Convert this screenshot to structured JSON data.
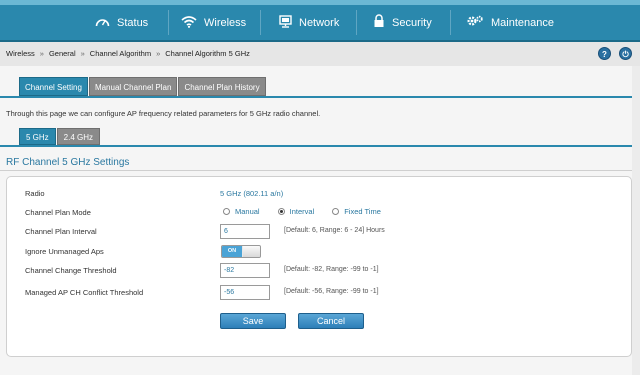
{
  "nav": {
    "items": [
      {
        "label": "Status",
        "icon": "gauge-icon"
      },
      {
        "label": "Wireless",
        "icon": "wifi-icon"
      },
      {
        "label": "Network",
        "icon": "network-icon"
      },
      {
        "label": "Security",
        "icon": "lock-icon"
      },
      {
        "label": "Maintenance",
        "icon": "gear-icon"
      }
    ],
    "active": "Wireless"
  },
  "breadcrumb": [
    "Wireless",
    "General",
    "Channel Algorithm",
    "Channel Algorithm 5 GHz"
  ],
  "breadcrumb_sep": "»",
  "help": {
    "help_label": "?",
    "logout_label": "⏻"
  },
  "tabs": [
    "Channel Setting",
    "Manual Channel Plan",
    "Channel Plan History"
  ],
  "intro": "Through this page we can configure AP frequency related parameters for 5 GHz radio channel.",
  "subtabs": [
    "5 GHz",
    "2.4 GHz"
  ],
  "section_title": "RF Channel 5 GHz Settings",
  "form": {
    "radio": {
      "label": "Radio",
      "value": "5 GHz (802.11 a/n)"
    },
    "plan_mode": {
      "label": "Channel Plan Mode",
      "options": [
        "Manual",
        "Interval",
        "Fixed Time"
      ],
      "selected": "Interval"
    },
    "plan_interval": {
      "label": "Channel Plan Interval",
      "value": "6",
      "hint": "[Default: 6, Range: 6 - 24] Hours"
    },
    "ignore_unmanaged": {
      "label": "Ignore Unmanaged Aps",
      "state": "ON"
    },
    "change_threshold": {
      "label": "Channel Change Threshold",
      "value": "-82",
      "hint": "[Default: -82, Range: -99 to -1]"
    },
    "conflict_threshold": {
      "label": "Managed AP CH Conflict Threshold",
      "value": "-56",
      "hint": "[Default: -56, Range: -99 to -1]"
    }
  },
  "buttons": {
    "save": "Save",
    "cancel": "Cancel"
  },
  "colors": {
    "accent": "#2a88ad",
    "link": "#2a78a0"
  }
}
